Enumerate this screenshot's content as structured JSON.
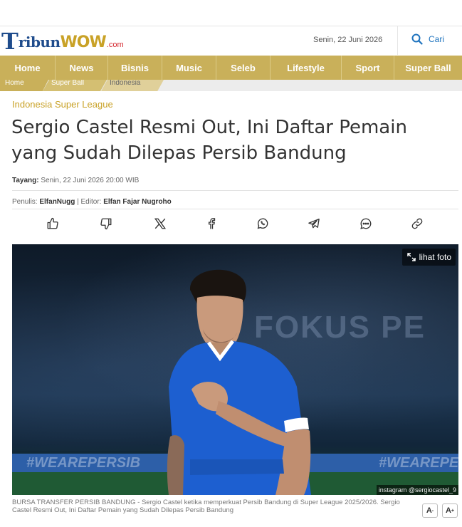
{
  "header": {
    "logo": {
      "t": "T",
      "ribun": "ribun",
      "wow": "WOW",
      "com": ".com"
    },
    "date": "Senin, 22 Juni 2026",
    "search_label": "Cari"
  },
  "nav": {
    "items": [
      {
        "label": "Home",
        "w": 78
      },
      {
        "label": "News",
        "w": 74
      },
      {
        "label": "Bisnis",
        "w": 76
      },
      {
        "label": "Music",
        "w": 76
      },
      {
        "label": "Seleb",
        "w": 76
      },
      {
        "label": "Lifestyle",
        "w": 100
      },
      {
        "label": "Sport",
        "w": 74
      },
      {
        "label": "Super Ball",
        "w": 95
      }
    ]
  },
  "breadcrumb": [
    "Home",
    "Super Ball",
    "Indonesia"
  ],
  "article": {
    "category": "Indonesia Super League",
    "title": "Sergio Castel Resmi Out, Ini Daftar Pemain yang Sudah Dilepas Persib Bandung",
    "tayang_label": "Tayang:",
    "tayang_value": "Senin, 22 Juni 2026 20:00 WIB",
    "penulis_label": "Penulis:",
    "penulis": "ElfanNugg",
    "editor_label": "| Editor:",
    "editor": "Elfan Fajar Nugroho"
  },
  "share_icons": [
    "thumbs-up-icon",
    "thumbs-down-icon",
    "x-icon",
    "facebook-icon",
    "whatsapp-icon",
    "telegram-icon",
    "comment-icon",
    "link-icon"
  ],
  "photo": {
    "lihat_foto": "lihat foto",
    "banner": "FOKUS PE",
    "board_left": "#WEAREPERSIB",
    "board_right": "#WEAREPE",
    "credit": "instagram @sergiocastel_9"
  },
  "caption": "BURSA TRANSFER PERSIB BANDUNG - Sergio Castel ketika memperkuat Persib Bandung di Super League 2025/2026. Sergio Castel Resmi Out, Ini Daftar Pemain yang Sudah Dilepas Persib Bandung",
  "font_controls": {
    "decrease": "A",
    "decrease_sup": "-",
    "increase": "A",
    "increase_sup": "+"
  },
  "colors": {
    "nav_gold": "#c9b05a",
    "brand_blue": "#1f4c8c",
    "accent_gold": "#c9a227",
    "link_blue": "#1e73be"
  }
}
